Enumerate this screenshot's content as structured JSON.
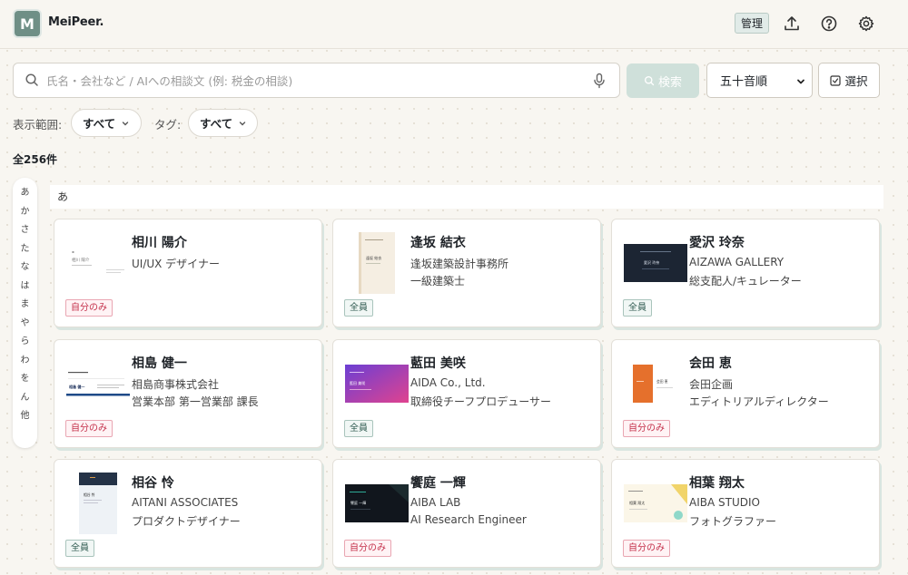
{
  "app": {
    "logo_letter": "M",
    "brand": "MeiPeer."
  },
  "header": {
    "admin_label": "管理",
    "icons": [
      "upload-icon",
      "help-icon",
      "settings-icon"
    ]
  },
  "search": {
    "placeholder": "氏名・会社など / AIへの相談文 (例: 税金の相談)",
    "value": "",
    "button_label": "検索",
    "sort_selected": "五十音順",
    "select_label": "選択"
  },
  "filters": {
    "scope_label": "表示範囲:",
    "scope_value": "すべて",
    "tag_label": "タグ:",
    "tag_value": "すべて"
  },
  "count_text": "全256件",
  "kana_index": [
    "あ",
    "か",
    "さ",
    "た",
    "な",
    "は",
    "ま",
    "や",
    "ら",
    "わ",
    "を",
    "ん",
    "他"
  ],
  "section": {
    "label": "あ"
  },
  "cards": [
    {
      "name": "相川 陽介",
      "line1": "UI/UX デザイナー",
      "line2": "",
      "badge": "自分のみ",
      "badge_type": "private",
      "thumb": "white-card"
    },
    {
      "name": "逢坂 結衣",
      "line1": "逢坂建築設計事務所",
      "line2": "一級建築士",
      "badge": "全員",
      "badge_type": "public",
      "thumb": "beige-vertical"
    },
    {
      "name": "愛沢 玲奈",
      "line1": "AIZAWA GALLERY",
      "line2": "総支配人/キュレーター",
      "badge": "全員",
      "badge_type": "public",
      "thumb": "dark-card"
    },
    {
      "name": "相島 健一",
      "line1": "相島商事株式会社",
      "line2": "営業本部 第一営業部 課長",
      "badge": "自分のみ",
      "badge_type": "private",
      "thumb": "blue-stripe"
    },
    {
      "name": "藍田 美咲",
      "line1": "AIDA Co., Ltd.",
      "line2": "取締役チーフプロデューサー",
      "badge": "全員",
      "badge_type": "public",
      "thumb": "gradient-card"
    },
    {
      "name": "会田 恵",
      "line1": "会田企画",
      "line2": "エディトリアルディレクター",
      "badge": "自分のみ",
      "badge_type": "private",
      "thumb": "orange-split"
    },
    {
      "name": "相谷 怜",
      "line1": "AITANI ASSOCIATES",
      "line2": "プロダクトデザイナー",
      "badge": "全員",
      "badge_type": "public",
      "thumb": "navy-vertical"
    },
    {
      "name": "饗庭 一輝",
      "line1": "AIBA LAB",
      "line2": "AI Research Engineer",
      "badge": "自分のみ",
      "badge_type": "private",
      "thumb": "dark-teal"
    },
    {
      "name": "相葉 翔太",
      "line1": "AIBA STUDIO",
      "line2": "フォトグラファー",
      "badge": "自分のみ",
      "badge_type": "private",
      "thumb": "cream-yellow"
    }
  ],
  "thumb_texts": {
    "t1": "相川 陽介",
    "t2": "逢坂 結衣",
    "t3": "愛沢 玲奈",
    "t4": "相島 健一",
    "t5": "藍田 美咲",
    "t6": "会田 恵",
    "t7": "相谷 怜",
    "t8": "饗庭 一輝",
    "t9": "相葉 翔太"
  },
  "colors": {
    "accent": "#6f8f86",
    "private": "#c4314b",
    "public": "#2e5a50",
    "background": "#f8f6f1"
  }
}
